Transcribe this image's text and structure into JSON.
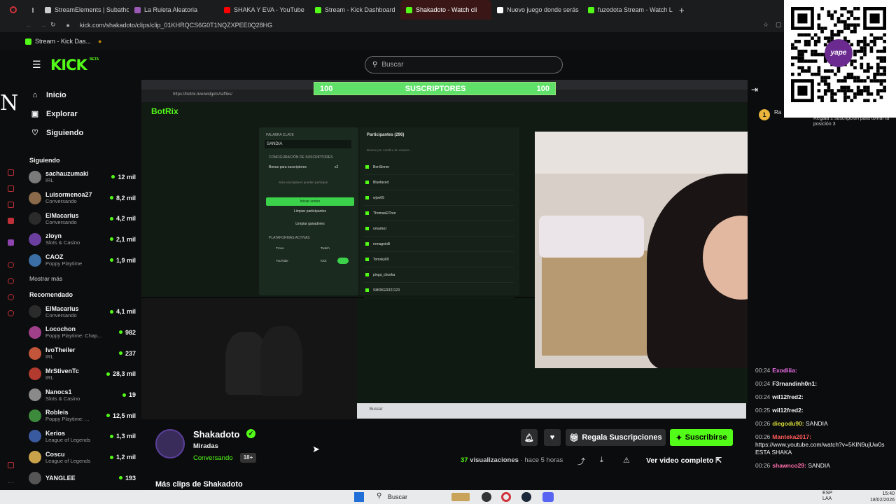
{
  "browser": {
    "tabs": [
      {
        "label": "StreamElements | Subatho",
        "color": "#cccccc"
      },
      {
        "label": "La Ruleta Aleatoria",
        "color": "#9b59b6"
      },
      {
        "label": "SHAKA Y EVA - YouTube",
        "color": "#ff0000"
      },
      {
        "label": "Stream - Kick Dashboard",
        "color": "#53fc18"
      },
      {
        "label": "Shakadoto - Watch cli",
        "color": "#53fc18"
      },
      {
        "label": "Nuevo juego donde serás",
        "color": "#ffffff"
      },
      {
        "label": "fuzodota Stream - Watch L",
        "color": "#53fc18"
      }
    ],
    "new_tab": "+",
    "url": "kick.com/shakadoto/clips/clip_01KHRQCS6G0T1NQZXPEE0Q28HG",
    "bookmark": "Stream - Kick Das..."
  },
  "header": {
    "logo": "KICK",
    "logo_badge": "BETA",
    "search_placeholder": "Buscar"
  },
  "nav": [
    {
      "label": "Inicio",
      "icon": "home-icon"
    },
    {
      "label": "Explorar",
      "icon": "browse-icon"
    },
    {
      "label": "Siguiendo",
      "icon": "heart-icon"
    }
  ],
  "following": {
    "title": "Siguiendo",
    "channels": [
      {
        "name": "sachauzumaki",
        "category": "IRL",
        "viewers": "12 mil",
        "color": "#7a7a7a"
      },
      {
        "name": "Luisormenoa27",
        "category": "Conversando",
        "viewers": "8,2 mil",
        "color": "#8a6a4a"
      },
      {
        "name": "ElMacarius",
        "category": "Conversando",
        "viewers": "4,2 mil",
        "color": "#2b2b2b"
      },
      {
        "name": "zloyn",
        "category": "Slots & Casino",
        "viewers": "2,1 mil",
        "color": "#6b3fa0"
      },
      {
        "name": "CAOZ",
        "category": "Poppy Playtime",
        "viewers": "1,9 mil",
        "color": "#3a6ea5"
      }
    ],
    "more": "Mostrar más"
  },
  "recommended": {
    "title": "Recomendado",
    "channels": [
      {
        "name": "ElMacarius",
        "category": "Conversando",
        "viewers": "4,1 mil",
        "color": "#2b2b2b"
      },
      {
        "name": "Locochon",
        "category": "Poppy Playtime: Chap...",
        "viewers": "982",
        "color": "#a03f8a"
      },
      {
        "name": "IvoTheiler",
        "category": "IRL",
        "viewers": "237",
        "color": "#c2553a"
      },
      {
        "name": "MrStivenTc",
        "category": "IRL",
        "viewers": "28,3 mil",
        "color": "#b23a2e"
      },
      {
        "name": "Nanocs1",
        "category": "Slots & Casino",
        "viewers": "19",
        "color": "#8a8a8a"
      },
      {
        "name": "Robleis",
        "category": "Poppy Playtime: ...",
        "viewers": "12,5 mil",
        "color": "#3d8a3d"
      },
      {
        "name": "Kerios",
        "category": "League of Legends",
        "viewers": "1,3 mil",
        "color": "#3a5aa0"
      },
      {
        "name": "Coscu",
        "category": "League of Legends",
        "viewers": "1,2 mil",
        "color": "#c9a24a"
      },
      {
        "name": "YANGLEE",
        "category": "",
        "viewers": "193",
        "color": "#555555"
      }
    ]
  },
  "stream": {
    "goal_left": "100",
    "goal_label": "SUSCRIPTORES",
    "goal_right": "100",
    "goal_progress": 1,
    "inner_title": "BotRix",
    "inner_url": "https://botrix.live/widgets/raffles/",
    "raffle": {
      "keyword_label": "PALABRA CLAVE",
      "keyword": "SANDIA",
      "subs_label": "CONFIGURACIÓN DE SUSCRIPTORES",
      "bonus_label": "Bonus para suscriptores",
      "bonus_value": "x2",
      "only_subs": "Solo suscriptores pueden participar",
      "start": "Iniciar sorteo",
      "clear_participants": "Limpiar participantes",
      "clear_winners": "Limpiar ganadores",
      "platforms_label": "PLATAFORMAS ACTIVAS",
      "platforms": [
        "Trovo",
        "Twitch",
        "YouTube",
        "Kick"
      ],
      "participants_title": "Participantes (296)",
      "participants_search": "Buscar por nombre de usuario...",
      "participants": [
        "BenSinner",
        "Bluefaced",
        "wjoe05",
        "ThomasElTren",
        "omarlezi",
        "romagniolli",
        "Tomsky69",
        "pinga_chueka",
        "SMOKER321123"
      ]
    },
    "inner_taskbar_search": "Buscar"
  },
  "clip": {
    "streamer": "Shakadoto",
    "title": "Miradas",
    "category": "Conversando",
    "age_badge": "18+",
    "views_count": "37",
    "views_label": "visualizaciones",
    "time_ago": "hace 5 horas",
    "gift_label": "Regala Suscripciones",
    "subscribe_label": "Suscribirse",
    "full_video_label": "Ver video completo",
    "more_clips": "Más clips de Shakadoto"
  },
  "chat": {
    "top_gift": "Regala 1 suscripción para tomar la posición 3",
    "top_name": "Ra",
    "messages": [
      {
        "time": "00:24",
        "user": "Exodiiia:",
        "user_color": "#f36ff0",
        "text": ""
      },
      {
        "time": "00:24",
        "user": "F3rnandinh0n1:",
        "user_color": "#f2f2f2",
        "text": ""
      },
      {
        "time": "00:24",
        "user": "wil12fred2:",
        "user_color": "#f2f2f2",
        "text": ""
      },
      {
        "time": "00:25",
        "user": "wil12fred2:",
        "user_color": "#f2f2f2",
        "text": ""
      },
      {
        "time": "00:26",
        "user": "diegodu90:",
        "user_color": "#d6d93c",
        "text": "SANDIA"
      },
      {
        "time": "00:26",
        "user": "Manteka2017:",
        "user_color": "#ff5a5a",
        "text": "https://www.youtube.com/watch?v=5KIN9ujUw0s ESTA SHAKA"
      },
      {
        "time": "00:26",
        "user": "shawnco29:",
        "user_color": "#ff6fae",
        "text": "SANDIA"
      }
    ]
  },
  "taskbar": {
    "search": "Buscar",
    "lang": "ESP LAA",
    "time": "15:40",
    "date": "18/02/2026"
  },
  "overlay_logo": "yape",
  "colors": {
    "accent": "#53fc18",
    "background": "#0b0c0d"
  }
}
